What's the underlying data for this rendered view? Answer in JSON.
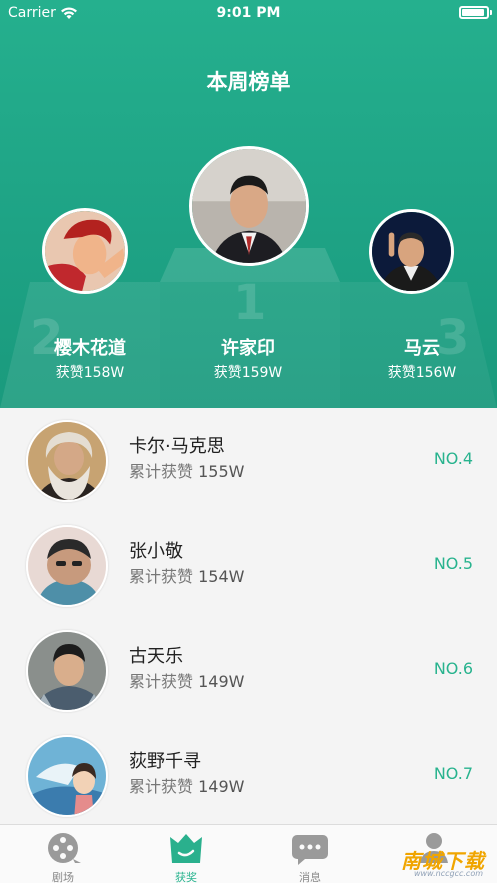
{
  "status_bar": {
    "carrier": "Carrier",
    "time": "9:01 PM"
  },
  "page_title": "本周榜单",
  "podium": {
    "first": {
      "name": "许家印",
      "likes": "获赞159W",
      "rank_digit": "1"
    },
    "second": {
      "name": "樱木花道",
      "likes": "获赞158W",
      "rank_digit": "2"
    },
    "third": {
      "name": "马云",
      "likes": "获赞156W",
      "rank_digit": "3"
    }
  },
  "ranking_list": [
    {
      "name": "卡尔·马克思",
      "stat_label": "累计获赞",
      "stat_value": "155W",
      "rank": "NO.4"
    },
    {
      "name": "张小敬",
      "stat_label": "累计获赞",
      "stat_value": "154W",
      "rank": "NO.5"
    },
    {
      "name": "古天乐",
      "stat_label": "累计获赞",
      "stat_value": "149W",
      "rank": "NO.6"
    },
    {
      "name": "荻野千寻",
      "stat_label": "累计获赞",
      "stat_value": "149W",
      "rank": "NO.7"
    }
  ],
  "tabbar": {
    "tabs": [
      {
        "label": "剧场",
        "icon": "film-reel-icon"
      },
      {
        "label": "获奖",
        "icon": "crown-trophy-icon",
        "active": true
      },
      {
        "label": "消息",
        "icon": "chat-bubble-icon"
      },
      {
        "label": "",
        "icon": "profile-icon"
      }
    ]
  },
  "watermark": {
    "text": "南城下载",
    "sub": "www.nccgcc.com"
  },
  "colors": {
    "primary": "#25b08e",
    "rank_text": "#28b38e",
    "background": "#f4f4f4"
  }
}
